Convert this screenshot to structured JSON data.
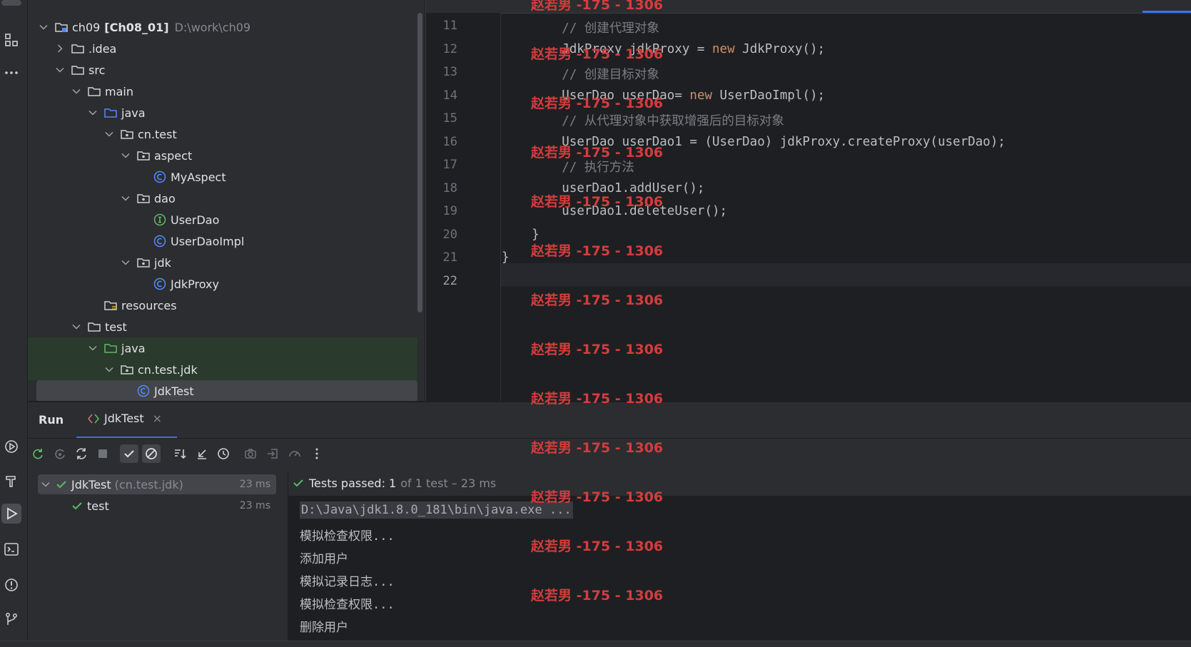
{
  "project_tree": [
    {
      "label": "ch09",
      "suffix": "[Ch08_01]",
      "path": "D:\\work\\ch09",
      "icon": "module-folder-icon",
      "depth": 0,
      "expanded": true
    },
    {
      "label": ".idea",
      "icon": "folder-icon",
      "depth": 1,
      "expanded": false
    },
    {
      "label": "src",
      "icon": "folder-icon",
      "depth": 1,
      "expanded": true
    },
    {
      "label": "main",
      "icon": "folder-icon",
      "depth": 2,
      "expanded": true
    },
    {
      "label": "java",
      "icon": "source-folder-icon",
      "depth": 3,
      "expanded": true
    },
    {
      "label": "cn.test",
      "icon": "package-icon",
      "depth": 4,
      "expanded": true
    },
    {
      "label": "aspect",
      "icon": "package-icon",
      "depth": 5,
      "expanded": true
    },
    {
      "label": "MyAspect",
      "icon": "class-icon",
      "depth": 6
    },
    {
      "label": "dao",
      "icon": "package-icon",
      "depth": 5,
      "expanded": true
    },
    {
      "label": "UserDao",
      "icon": "interface-icon",
      "depth": 6
    },
    {
      "label": "UserDaoImpl",
      "icon": "class-icon",
      "depth": 6
    },
    {
      "label": "jdk",
      "icon": "package-icon",
      "depth": 5,
      "expanded": true
    },
    {
      "label": "JdkProxy",
      "icon": "class-icon",
      "depth": 6
    },
    {
      "label": "resources",
      "icon": "resources-folder-icon",
      "depth": 3
    },
    {
      "label": "test",
      "icon": "folder-icon",
      "depth": 2,
      "expanded": true
    },
    {
      "label": "java",
      "icon": "test-source-folder-icon",
      "depth": 3,
      "expanded": true
    },
    {
      "label": "cn.test.jdk",
      "icon": "package-icon",
      "depth": 4,
      "expanded": true
    },
    {
      "label": "JdkTest",
      "icon": "class-icon",
      "depth": 5,
      "selected": true
    }
  ],
  "editor": {
    "lines": [
      {
        "num": "11",
        "tokens": [
          {
            "t": "        // 创建代理对象",
            "c": "cm"
          }
        ]
      },
      {
        "num": "12",
        "tokens": [
          {
            "t": "        JdkProxy jdkProxy = ",
            "c": ""
          },
          {
            "t": "new",
            "c": "kw"
          },
          {
            "t": " JdkProxy();",
            "c": ""
          }
        ]
      },
      {
        "num": "13",
        "tokens": [
          {
            "t": "        // 创建目标对象",
            "c": "cm"
          }
        ]
      },
      {
        "num": "14",
        "tokens": [
          {
            "t": "        UserDao userDao= ",
            "c": ""
          },
          {
            "t": "new",
            "c": "kw"
          },
          {
            "t": " UserDaoImpl();",
            "c": ""
          }
        ]
      },
      {
        "num": "15",
        "tokens": [
          {
            "t": "        // 从代理对象中获取增强后的目标对象",
            "c": "cm"
          }
        ]
      },
      {
        "num": "16",
        "tokens": [
          {
            "t": "        UserDao userDao1 = (UserDao) jdkProxy.createProxy(userDao);",
            "c": ""
          }
        ]
      },
      {
        "num": "17",
        "tokens": [
          {
            "t": "        // 执行方法",
            "c": "cm"
          }
        ]
      },
      {
        "num": "18",
        "tokens": [
          {
            "t": "        userDao1.addUser();",
            "c": ""
          }
        ]
      },
      {
        "num": "19",
        "tokens": [
          {
            "t": "        userDao1.deleteUser();",
            "c": ""
          }
        ]
      },
      {
        "num": "20",
        "tokens": [
          {
            "t": "    }",
            "c": ""
          }
        ]
      },
      {
        "num": "21",
        "tokens": [
          {
            "t": "}",
            "c": ""
          }
        ]
      },
      {
        "num": "22",
        "tokens": [
          {
            "t": "",
            "c": ""
          }
        ],
        "current": true
      }
    ]
  },
  "watermark": {
    "text": "赵若男 -175 - 1306",
    "color": "#d33d3d"
  },
  "run_panel": {
    "title": "Run",
    "tab_label": "JdkTest",
    "tab_close": "×",
    "tests": [
      {
        "label": "JdkTest",
        "detail": "(cn.test.jdk)",
        "duration": "23 ms",
        "selected": true
      },
      {
        "label": "test",
        "detail": "",
        "duration": "23 ms"
      }
    ],
    "status_passed": "Tests passed: 1",
    "status_detail": "of 1 test – 23 ms",
    "console_lines": [
      "D:\\Java\\jdk1.8.0_181\\bin\\java.exe ...",
      "模拟检查权限...",
      "添加用户",
      "模拟记录日志...",
      "模拟检查权限...",
      "删除用户"
    ]
  },
  "colors": {
    "pass_green": "#5fb865",
    "accent_blue": "#3574f0",
    "class_icon": "#548af7",
    "interface_icon": "#5fb865"
  }
}
